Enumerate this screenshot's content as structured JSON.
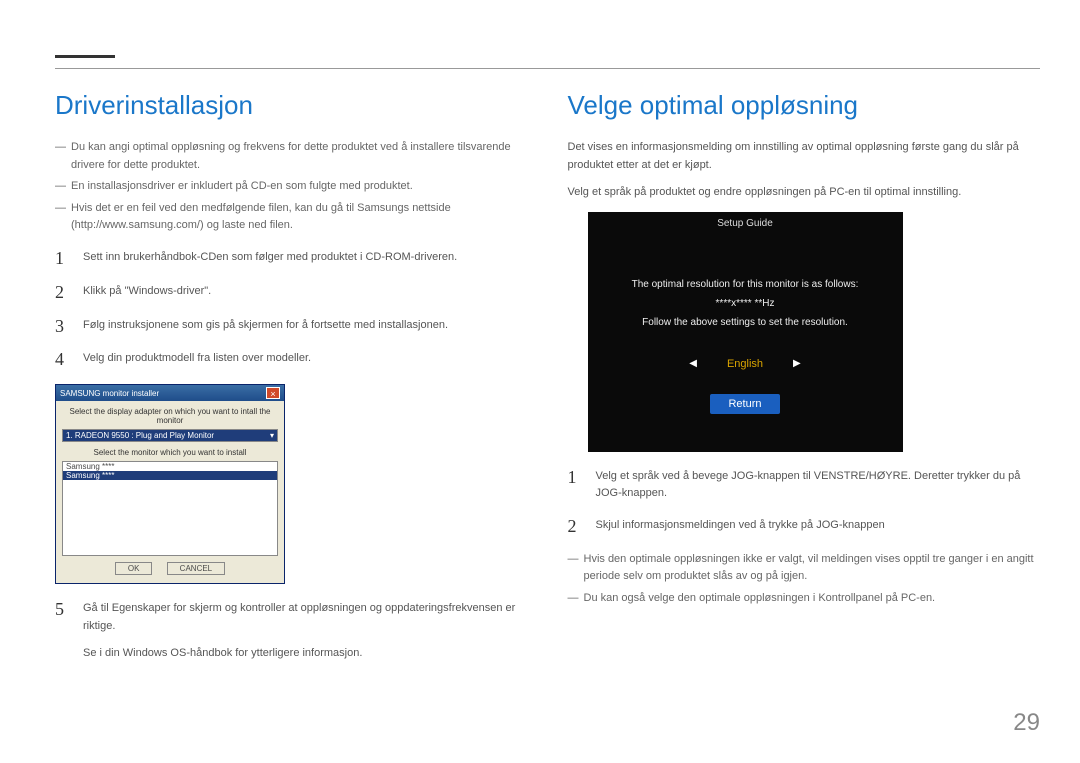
{
  "left": {
    "title": "Driverinstallasjon",
    "notes": [
      "Du kan angi optimal oppløsning og frekvens for dette produktet ved å installere tilsvarende drivere for dette produktet.",
      "En installasjonsdriver er inkludert på CD-en som fulgte med produktet.",
      "Hvis det er en feil ved den medfølgende filen, kan du gå til Samsungs nettside (http://www.samsung.com/) og laste ned filen."
    ],
    "steps": [
      "Sett inn brukerhåndbok-CDen som følger med produktet i CD-ROM-driveren.",
      "Klikk på \"Windows-driver\".",
      "Følg instruksjonene som gis på skjermen for å fortsette med installasjonen.",
      "Velg din produktmodell fra listen over modeller."
    ],
    "installer": {
      "title": "SAMSUNG monitor installer",
      "label1": "Select the display adapter on which you want to intall the monitor",
      "adapter": "1. RADEON 9550 : Plug and Play Monitor",
      "label2": "Select the monitor which you want to install",
      "row1": "Samsung ****",
      "row2": "Samsung ****",
      "ok": "OK",
      "cancel": "CANCEL"
    },
    "step5": "Gå til Egenskaper for skjerm og kontroller at oppløsningen og oppdateringsfrekvensen er riktige.",
    "step5b": "Se i din Windows OS-håndbok for ytterligere informasjon."
  },
  "right": {
    "title": "Velge optimal oppløsning",
    "para1": "Det vises en informasjonsmelding om innstilling av optimal oppløsning første gang du slår på produktet etter at det er kjøpt.",
    "para2": "Velg et språk på produktet og endre oppløsningen på PC-en til optimal innstilling.",
    "osd": {
      "title": "Setup Guide",
      "line1": "The optimal resolution for this monitor is as follows:",
      "line2": "****x**** **Hz",
      "line3": "Follow the above settings to set the resolution.",
      "lang": "English",
      "return": "Return"
    },
    "steps": [
      "Velg et språk ved å bevege JOG-knappen til VENSTRE/HØYRE. Deretter trykker du på JOG-knappen.",
      "Skjul informasjonsmeldingen ved å trykke på JOG-knappen"
    ],
    "notes": [
      "Hvis den optimale oppløsningen ikke er valgt, vil meldingen vises opptil tre ganger i en angitt periode selv om produktet slås av og på igjen.",
      "Du kan også velge den optimale oppløsningen i Kontrollpanel på PC-en."
    ]
  },
  "pageNumber": "29"
}
